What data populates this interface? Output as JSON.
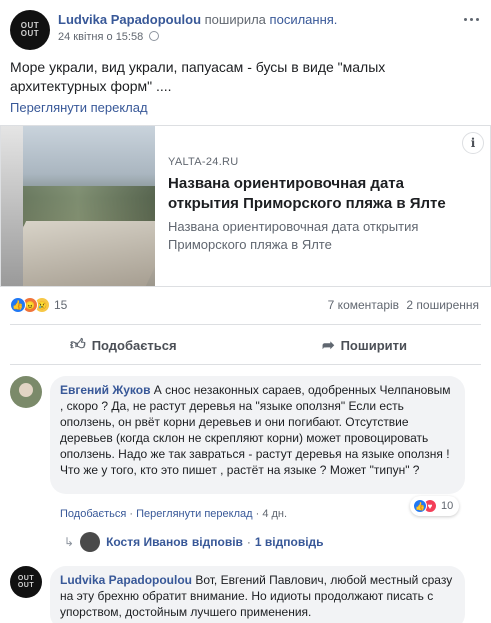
{
  "post": {
    "author": "Ludvika Papadopoulou",
    "action_verb": "поширила",
    "action_object": "посилання.",
    "timestamp": "24 квітня о 15:58",
    "more_icon": "ellipsis-icon",
    "text": "Море украли, вид украли, папуасам - бусы в виде \"малых архитектурных форм\" ....",
    "translate_link": "Переглянути переклад"
  },
  "link_card": {
    "domain": "YALTA-24.RU",
    "title": "Названа ориентировочная дата открытия Приморского пляжа в Ялте",
    "description": "Названа ориентировочная дата открытия Приморского пляжа в Ялте",
    "info_icon": "i"
  },
  "reactions": {
    "count": "15",
    "comments": "7 коментарів",
    "shares": "2 поширення"
  },
  "actions": {
    "like": "Подобається",
    "share": "Поширити"
  },
  "comment1": {
    "author": "Евгений Жуков",
    "text": " А снос незаконных сараев, одобренных Челпановым , скоро ? Да, не растут деревья на \"языке оползня\" Если есть оползень, он рвёт корни деревьев и они погибают. Отсутствие деревьев (когда склон не скрепляют корни) может провоцировать оползень. Надо же так завраться - растут деревья на языке оползня ! Что же у того, кто это пишет , растёт на языке ? Может \"типун\" ?",
    "like_link": "Подобається",
    "translate_link": "Переглянути переклад",
    "time": "4 дн.",
    "sep": "·",
    "reaction_count": "10"
  },
  "reply_summary": {
    "author": "Костя Иванов",
    "replied": "відповів",
    "sep": "·",
    "replies": "1 відповідь"
  },
  "comment2": {
    "author": "Ludvika Papadopoulou",
    "text": " Вот, Евгений Павлович, любой местный сразу на эту брехню обратит внимание. Но идиоты продолжают писать с упорством, достойным лучшего применения."
  },
  "avatar_text": "OUT OUT"
}
